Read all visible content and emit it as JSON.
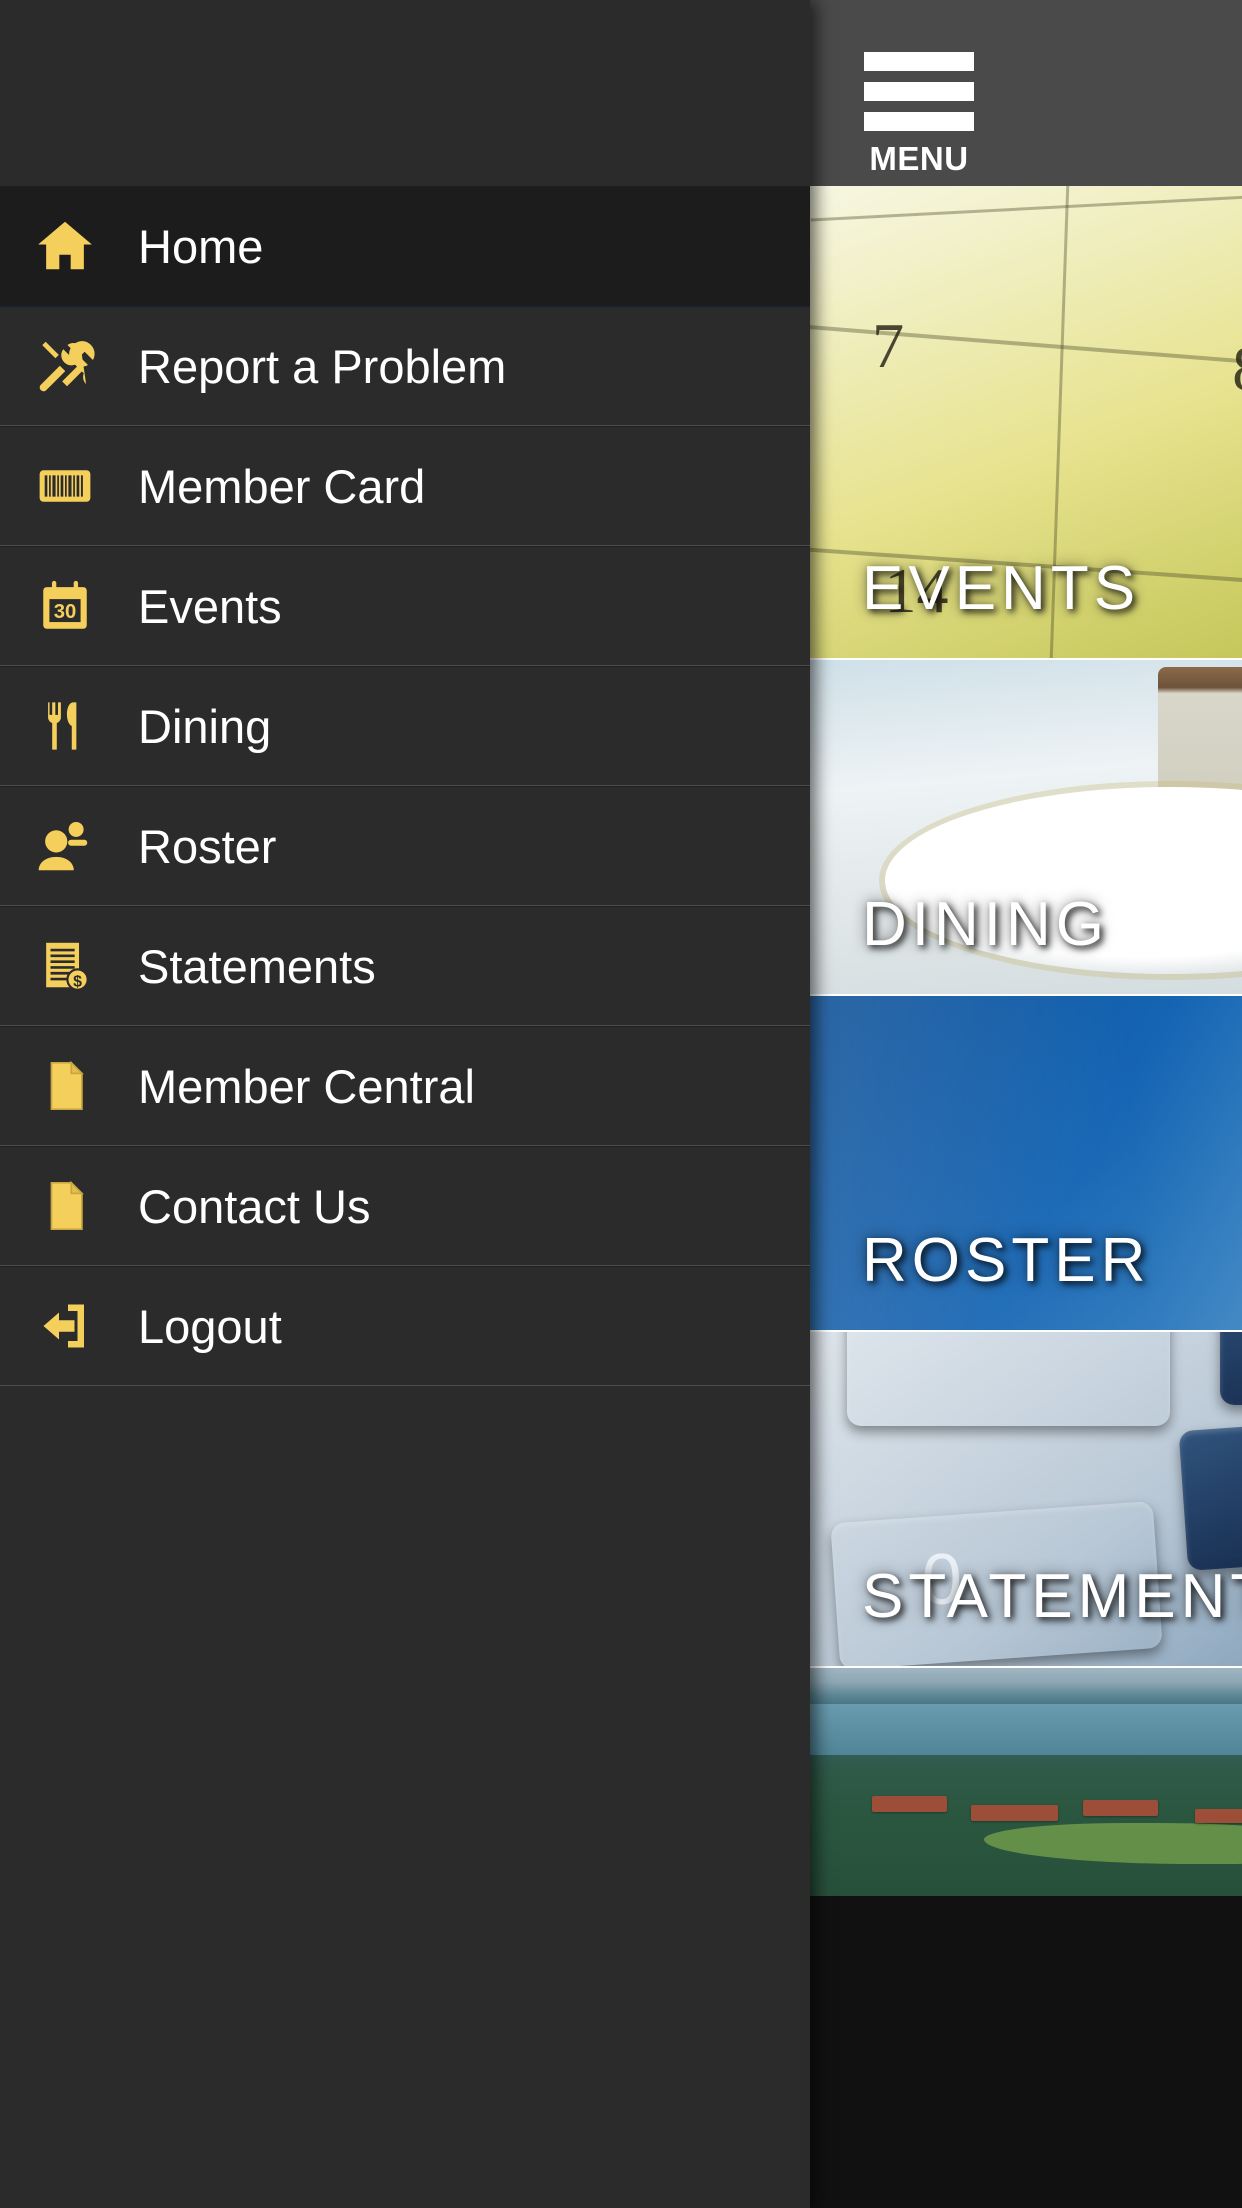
{
  "topbar": {
    "menu_button_label": "MENU",
    "menu_icon": "hamburger-menu-icon",
    "background_color": "#4a4a4a"
  },
  "theme": {
    "drawer_background": "#2b2b2b",
    "drawer_selected_background": "#1c1c1c",
    "icon_accent_color": "#f5cf5c",
    "label_color": "#ffffff",
    "separator_color": "#4e4e4e"
  },
  "drawer": {
    "items": [
      {
        "label": "Home",
        "icon": "home-icon",
        "selected": true
      },
      {
        "label": "Report a Problem",
        "icon": "tools-icon",
        "selected": false
      },
      {
        "label": "Member Card",
        "icon": "barcode-icon",
        "selected": false
      },
      {
        "label": "Events",
        "icon": "calendar-icon",
        "selected": false,
        "icon_text": "30"
      },
      {
        "label": "Dining",
        "icon": "cutlery-icon",
        "selected": false
      },
      {
        "label": "Roster",
        "icon": "people-icon",
        "selected": false
      },
      {
        "label": "Statements",
        "icon": "invoice-icon",
        "selected": false
      },
      {
        "label": "Member Central",
        "icon": "page-icon",
        "selected": false
      },
      {
        "label": "Contact Us",
        "icon": "page-icon",
        "selected": false
      },
      {
        "label": "Logout",
        "icon": "logout-arrow-icon",
        "selected": false
      }
    ]
  },
  "content": {
    "tiles": [
      {
        "label": "EVENTS",
        "image": "calendar-photo",
        "style": "events"
      },
      {
        "label": "DINING",
        "image": "table-setting-photo",
        "style": "dining"
      },
      {
        "label": "ROSTER",
        "image": "file-cards-photo",
        "style": "roster"
      },
      {
        "label": "STATEMENTS",
        "image": "calculator-photo",
        "style": "statements"
      },
      {
        "label": "",
        "image": "aerial-community-photo",
        "style": "community"
      }
    ]
  }
}
